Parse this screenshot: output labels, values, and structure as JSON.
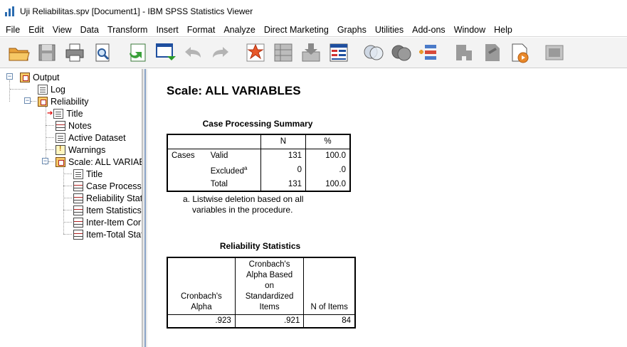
{
  "window": {
    "title": "Uji Reliabilitas.spv [Document1] - IBM SPSS Statistics Viewer"
  },
  "menu": [
    "File",
    "Edit",
    "View",
    "Data",
    "Transform",
    "Insert",
    "Format",
    "Analyze",
    "Direct Marketing",
    "Graphs",
    "Utilities",
    "Add-ons",
    "Window",
    "Help"
  ],
  "toolbar": [
    "open-folder-icon",
    "save-icon",
    "print-icon",
    "print-preview-icon",
    "export-icon",
    "designate-window-icon",
    "undo-icon",
    "redo-icon",
    "goto-data-icon",
    "goto-case-icon",
    "insert-cases-icon",
    "variables-icon",
    "show-all-variables-icon",
    "select-cases-icon",
    "value-labels-icon",
    "use-variable-sets-icon",
    "insert-heading-icon",
    "insert-title-icon",
    "insert-text-icon",
    "run-script-icon"
  ],
  "outline": {
    "output": "Output",
    "log": "Log",
    "reliability": "Reliability",
    "title": "Title",
    "notes": "Notes",
    "active_dataset": "Active Dataset",
    "warnings": "Warnings",
    "scale": "Scale: ALL VARIABLES",
    "scale_title": "Title",
    "case_processing": "Case Processing Summary",
    "reliability_stats": "Reliability Statistics",
    "item_stats": "Item Statistics",
    "inter_item": "Inter-Item Correlation Matrix",
    "item_total": "Item-Total Statistics"
  },
  "content": {
    "heading": "Scale: ALL VARIABLES",
    "case_summary": {
      "title": "Case Processing Summary",
      "col_n": "N",
      "col_pct": "%",
      "group": "Cases",
      "rows": [
        {
          "label": "Valid",
          "n": "131",
          "pct": "100.0"
        },
        {
          "label": "Excluded",
          "sup": "a",
          "n": "0",
          "pct": ".0"
        },
        {
          "label": "Total",
          "n": "131",
          "pct": "100.0"
        }
      ],
      "footnote_1": "a. Listwise deletion based on all",
      "footnote_2": "variables in the procedure."
    },
    "reliability_stats": {
      "title": "Reliability Statistics",
      "col_alpha_1": "Cronbach's",
      "col_alpha_2": "Alpha",
      "col_std_1": "Cronbach's",
      "col_std_2": "Alpha Based",
      "col_std_3": "on",
      "col_std_4": "Standardized",
      "col_std_5": "Items",
      "col_items": "N of Items",
      "alpha": ".923",
      "alpha_std": ".921",
      "n_items": "84"
    }
  }
}
